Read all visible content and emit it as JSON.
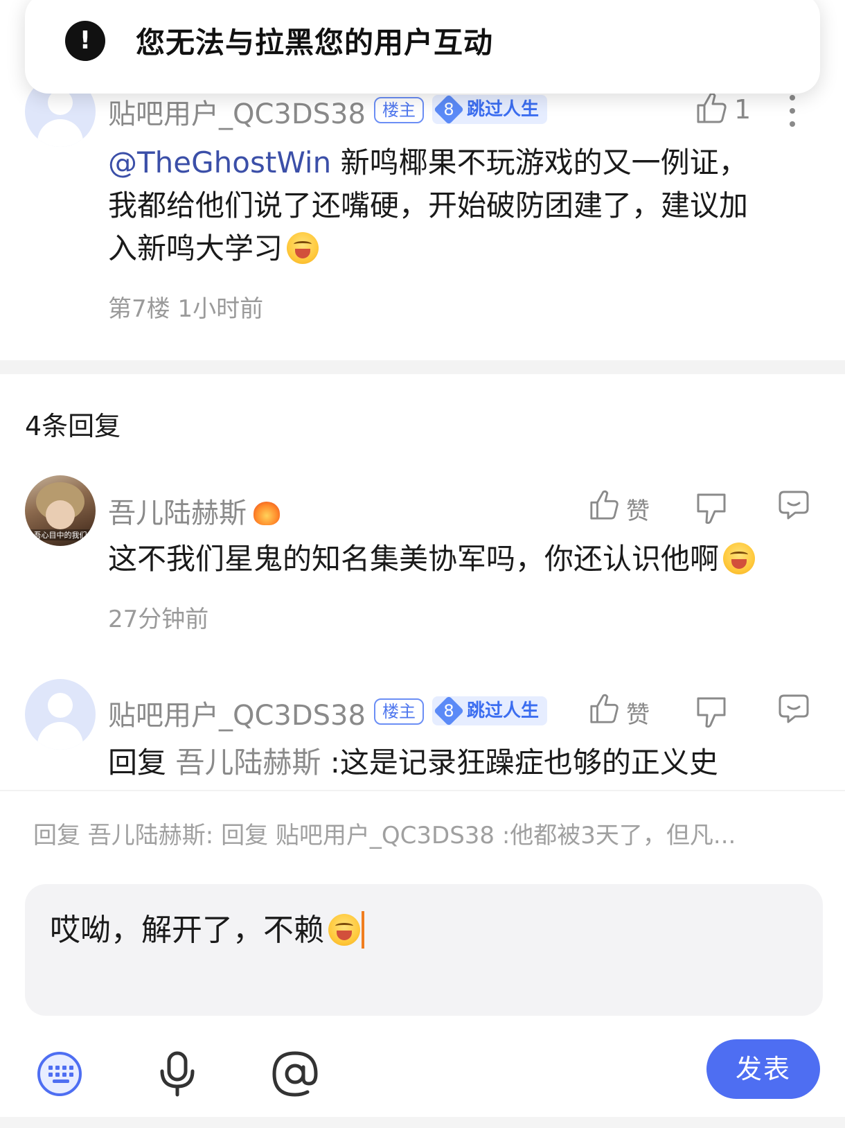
{
  "toast": {
    "icon": "exclamation-icon",
    "symbol": "!",
    "message": "您无法与拉黑您的用户互动"
  },
  "main_post": {
    "username": "贴吧用户_QC3DS38",
    "owner_badge": "楼主",
    "level": "8",
    "level_title": "跳过人生",
    "like_count": "1",
    "mention": "@TheGhostWin",
    "text_line1": " 新鸣椰果不玩游戏的又一例证，",
    "text_line2": "我都给他们说了还嘴硬，开始破防团建了，建议加",
    "text_line3": "入新鸣大学习",
    "meta": "第7楼 1小时前"
  },
  "replies_header": "4条回复",
  "replies": [
    {
      "username": "吾儿陆赫斯",
      "avatar_caption": "吾心目中的我们",
      "text": "这不我们星鬼的知名集美协军吗，你还认识他啊",
      "time": "27分钟前",
      "like_label": "赞"
    },
    {
      "username": "贴吧用户_QC3DS38",
      "owner_badge": "楼主",
      "level": "8",
      "level_title": "跳过人生",
      "reply_prefix": "回复",
      "reply_target": " 吾儿陆赫斯 ",
      "text": ":这是记录狂躁症也够的正义史",
      "like_label": "赞"
    }
  ],
  "composer": {
    "quote": "回复 吾儿陆赫斯: 回复 贴吧用户_QC3DS38 :他都被3天了，但凡...",
    "input_value": "哎呦，解开了，不赖",
    "send_label": "发表"
  },
  "colors": {
    "accent": "#4e6ef2",
    "mention": "#3b4fa8",
    "caret": "#f07d1f",
    "level_badge": "#5b8af7"
  }
}
